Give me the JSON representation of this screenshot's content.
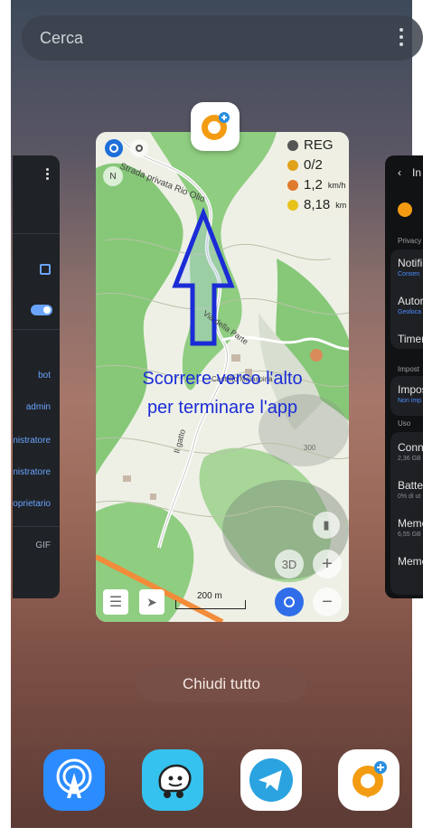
{
  "search": {
    "placeholder": "Cerca"
  },
  "main_app": {
    "stats": {
      "mode": "REG",
      "count": "0/2",
      "speed": "1,2",
      "speed_unit": "km/h",
      "distance": "8,18",
      "distance_unit": "km"
    },
    "map_labels": {
      "road": "Strada privata Rio Olio",
      "road2": "Via della Parte",
      "road3": "Il gatto",
      "place": "Castello Malaspina",
      "contour": "300",
      "contour2": "300"
    },
    "overlay_line1": "Scorrere verso l'alto",
    "overlay_line2": "per terminare l'app",
    "scale": "200 m",
    "btn_3d": "3D",
    "compass": "N"
  },
  "left_card": {
    "rows": [
      "bot",
      "admin",
      "inistratore",
      "inistratore",
      "roprietario",
      "GIF"
    ]
  },
  "right_card": {
    "header": "In",
    "items": [
      {
        "title": "Notific",
        "sub": "Consen",
        "sub_color": "blue"
      },
      {
        "title": "Autori",
        "sub": "Geoloca",
        "sub_color": "blue"
      },
      {
        "title": "Timer",
        "sub": ""
      },
      {
        "title": "Impos",
        "sub": "Non imp",
        "sub_color": "blue"
      },
      {
        "title": "Conne",
        "sub": "2,36 GB"
      },
      {
        "title": "Batter",
        "sub": "0% di ut"
      },
      {
        "title": "Memo",
        "sub": "6,55 GB"
      },
      {
        "title": "Memo",
        "sub": ""
      }
    ],
    "sections": [
      "Privacy",
      "Impost",
      "Uso"
    ]
  },
  "close_all": "Chiudi tutto",
  "dock": [
    "app-broadcast",
    "waze",
    "telegram",
    "osmand"
  ],
  "colors": {
    "osmand_orange": "#f39c12",
    "overlay_blue": "#1a2cd6",
    "map_green": "#7dc36b"
  }
}
